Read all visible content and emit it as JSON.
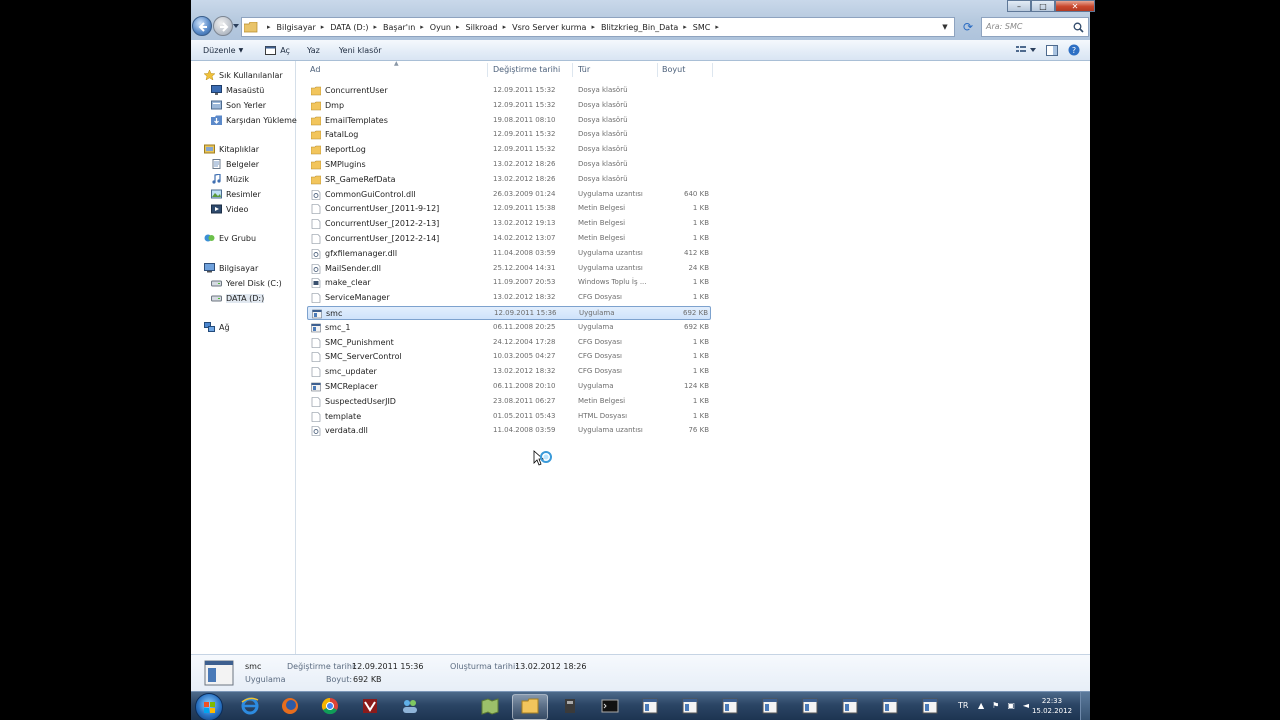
{
  "addressbar": {
    "breadcrumbs": [
      "Bilgisayar",
      "DATA (D:)",
      "Başar'ın",
      "Oyun",
      "Silkroad",
      "Vsro Server kurma",
      "Blitzkrieg_Bin_Data",
      "SMC"
    ],
    "search_placeholder": "Ara: SMC"
  },
  "toolbar": {
    "organize": "Düzenle",
    "open": "Aç",
    "write": "Yaz",
    "new_folder": "Yeni klasör"
  },
  "sidebar": {
    "items": [
      {
        "label": "Sık Kullanılanlar",
        "icon": "star-icon"
      },
      {
        "label": "Masaüstü",
        "icon": "desktop-icon"
      },
      {
        "label": "Son Yerler",
        "icon": "recent-places-icon"
      },
      {
        "label": "Karşıdan Yüklemeler",
        "icon": "downloads-icon"
      },
      {
        "label": "Kitaplıklar",
        "icon": "libraries-icon"
      },
      {
        "label": "Belgeler",
        "icon": "documents-icon"
      },
      {
        "label": "Müzik",
        "icon": "music-icon"
      },
      {
        "label": "Resimler",
        "icon": "pictures-icon"
      },
      {
        "label": "Video",
        "icon": "video-icon"
      },
      {
        "label": "Ev Grubu",
        "icon": "homegroup-icon"
      },
      {
        "label": "Bilgisayar",
        "icon": "computer-icon"
      },
      {
        "label": "Yerel Disk (C:)",
        "icon": "drive-icon"
      },
      {
        "label": "DATA (D:)",
        "icon": "drive-icon"
      },
      {
        "label": "Ağ",
        "icon": "network-icon"
      }
    ]
  },
  "columns": {
    "name": "Ad",
    "date": "Değiştirme tarihi",
    "type": "Tür",
    "size": "Boyut"
  },
  "files": [
    {
      "name": "ConcurrentUser",
      "date": "12.09.2011 15:32",
      "type": "Dosya klasörü",
      "size": "",
      "kind": "folder"
    },
    {
      "name": "Dmp",
      "date": "12.09.2011 15:32",
      "type": "Dosya klasörü",
      "size": "",
      "kind": "folder"
    },
    {
      "name": "EmailTemplates",
      "date": "19.08.2011 08:10",
      "type": "Dosya klasörü",
      "size": "",
      "kind": "folder"
    },
    {
      "name": "FatalLog",
      "date": "12.09.2011 15:32",
      "type": "Dosya klasörü",
      "size": "",
      "kind": "folder"
    },
    {
      "name": "ReportLog",
      "date": "12.09.2011 15:32",
      "type": "Dosya klasörü",
      "size": "",
      "kind": "folder"
    },
    {
      "name": "SMPlugins",
      "date": "13.02.2012 18:26",
      "type": "Dosya klasörü",
      "size": "",
      "kind": "folder"
    },
    {
      "name": "SR_GameRefData",
      "date": "13.02.2012 18:26",
      "type": "Dosya klasörü",
      "size": "",
      "kind": "folder"
    },
    {
      "name": "CommonGuiControl.dll",
      "date": "26.03.2009 01:24",
      "type": "Uygulama uzantısı",
      "size": "640 KB",
      "kind": "dll"
    },
    {
      "name": "ConcurrentUser_[2011-9-12]",
      "date": "12.09.2011 15:38",
      "type": "Metin Belgesi",
      "size": "1 KB",
      "kind": "text"
    },
    {
      "name": "ConcurrentUser_[2012-2-13]",
      "date": "13.02.2012 19:13",
      "type": "Metin Belgesi",
      "size": "1 KB",
      "kind": "text"
    },
    {
      "name": "ConcurrentUser_[2012-2-14]",
      "date": "14.02.2012 13:07",
      "type": "Metin Belgesi",
      "size": "1 KB",
      "kind": "text"
    },
    {
      "name": "gfxfilemanager.dll",
      "date": "11.04.2008 03:59",
      "type": "Uygulama uzantısı",
      "size": "412 KB",
      "kind": "dll"
    },
    {
      "name": "MailSender.dll",
      "date": "25.12.2004 14:31",
      "type": "Uygulama uzantısı",
      "size": "24 KB",
      "kind": "dll"
    },
    {
      "name": "make_clear",
      "date": "11.09.2007 20:53",
      "type": "Windows Toplu İş ...",
      "size": "1 KB",
      "kind": "batch"
    },
    {
      "name": "ServiceManager",
      "date": "13.02.2012 18:32",
      "type": "CFG Dosyası",
      "size": "1 KB",
      "kind": "text"
    },
    {
      "name": "smc",
      "date": "12.09.2011 15:36",
      "type": "Uygulama",
      "size": "692 KB",
      "kind": "exe",
      "selected": true
    },
    {
      "name": "smc_1",
      "date": "06.11.2008 20:25",
      "type": "Uygulama",
      "size": "692 KB",
      "kind": "exe"
    },
    {
      "name": "SMC_Punishment",
      "date": "24.12.2004 17:28",
      "type": "CFG Dosyası",
      "size": "1 KB",
      "kind": "text"
    },
    {
      "name": "SMC_ServerControl",
      "date": "10.03.2005 04:27",
      "type": "CFG Dosyası",
      "size": "1 KB",
      "kind": "text"
    },
    {
      "name": "smc_updater",
      "date": "13.02.2012 18:32",
      "type": "CFG Dosyası",
      "size": "1 KB",
      "kind": "text"
    },
    {
      "name": "SMCReplacer",
      "date": "06.11.2008 20:10",
      "type": "Uygulama",
      "size": "124 KB",
      "kind": "exe"
    },
    {
      "name": "SuspectedUserJID",
      "date": "23.08.2011 06:27",
      "type": "Metin Belgesi",
      "size": "1 KB",
      "kind": "text"
    },
    {
      "name": "template",
      "date": "01.05.2011 05:43",
      "type": "HTML Dosyası",
      "size": "1 KB",
      "kind": "text"
    },
    {
      "name": "verdata.dll",
      "date": "11.04.2008 03:59",
      "type": "Uygulama uzantısı",
      "size": "76 KB",
      "kind": "dll"
    }
  ],
  "details": {
    "name": "smc",
    "type": "Uygulama",
    "modified_label": "Değiştirme tarihi:",
    "modified_value": "12.09.2011 15:36",
    "created_label": "Oluşturma tarihi:",
    "created_value": "13.02.2012 18:26",
    "size_label": "Boyut:",
    "size_value": "692 KB"
  },
  "taskbar": {
    "language": "TR",
    "time": "22:33",
    "date": "15.02.2012",
    "buttons": [
      "internet-explorer-icon",
      "firefox-icon",
      "chrome-icon",
      "winrar-icon",
      "people-icon",
      "map-icon",
      "explorer-icon",
      "tools-icon",
      "cmd-icon",
      "window-icon",
      "window-icon",
      "window-icon",
      "window-icon",
      "window-icon",
      "window-icon",
      "window-icon",
      "window-icon"
    ],
    "active_index": 6
  },
  "colors": {
    "selection_bg": "#cfe3fb",
    "selection_border": "#7da2ce",
    "folder": "#f2c55c"
  }
}
